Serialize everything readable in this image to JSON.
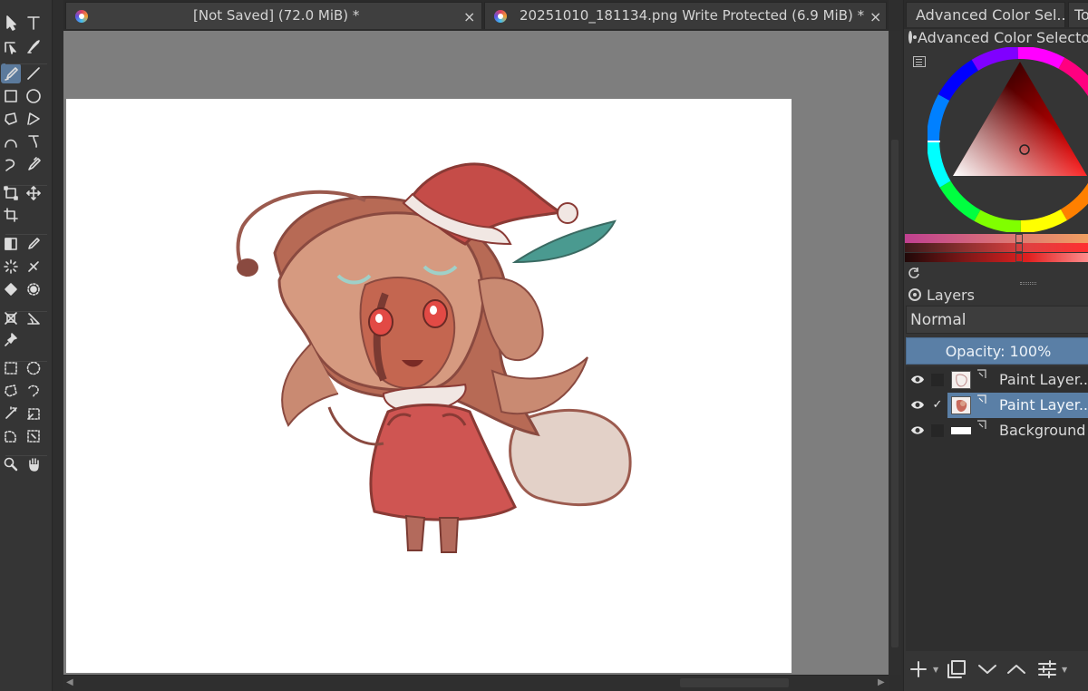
{
  "toolbox": {
    "tools": [
      {
        "name": "select-shapes-icon",
        "row": 0
      },
      {
        "name": "text-tool-icon",
        "row": 0
      },
      {
        "name": "edit-shapes-icon",
        "row": 1
      },
      {
        "name": "calligraphy-icon",
        "row": 1
      },
      {
        "name": "freehand-brush-icon",
        "row": 2,
        "active": true
      },
      {
        "name": "line-tool-icon",
        "row": 2
      },
      {
        "name": "rectangle-tool-icon",
        "row": 3
      },
      {
        "name": "ellipse-tool-icon",
        "row": 3
      },
      {
        "name": "polygon-tool-icon",
        "row": 4
      },
      {
        "name": "polyline-tool-icon",
        "row": 4
      },
      {
        "name": "bezier-curve-icon",
        "row": 5
      },
      {
        "name": "freehand-path-icon",
        "row": 5
      },
      {
        "name": "dynamic-brush-icon",
        "row": 6
      },
      {
        "name": "multibrush-icon",
        "row": 6
      },
      {
        "name": "transform-tool-icon",
        "row": 7
      },
      {
        "name": "move-tool-icon",
        "row": 7
      },
      {
        "name": "crop-tool-icon",
        "row": 8
      },
      {
        "name": "gradient-tool-icon",
        "row": 9
      },
      {
        "name": "color-picker-icon",
        "row": 9
      },
      {
        "name": "colorize-mask-icon",
        "row": 10
      },
      {
        "name": "smart-patch-icon",
        "row": 10
      },
      {
        "name": "fill-tool-icon",
        "row": 11
      },
      {
        "name": "enclose-fill-icon",
        "row": 11
      },
      {
        "name": "assistant-tool-icon",
        "row": 12
      },
      {
        "name": "measure-tool-icon",
        "row": 12
      },
      {
        "name": "reference-images-icon",
        "row": 13
      },
      {
        "name": "rectangular-selection-icon",
        "row": 14
      },
      {
        "name": "elliptical-selection-icon",
        "row": 14
      },
      {
        "name": "polygonal-selection-icon",
        "row": 15
      },
      {
        "name": "freehand-selection-icon",
        "row": 15
      },
      {
        "name": "contiguous-selection-icon",
        "row": 16
      },
      {
        "name": "similar-color-selection-icon",
        "row": 16
      },
      {
        "name": "bezier-selection-icon",
        "row": 17
      },
      {
        "name": "magnetic-selection-icon",
        "row": 17
      },
      {
        "name": "zoom-tool-icon",
        "row": 18
      },
      {
        "name": "pan-tool-icon",
        "row": 18
      }
    ]
  },
  "tabs": [
    {
      "title": "[Not Saved]  (72.0 MiB) *",
      "close": "×",
      "active": true
    },
    {
      "title": "20251010_181134.png Write Protected (6.9 MiB) *",
      "close": "×",
      "active": false
    }
  ],
  "dock_tabs": [
    {
      "label": "Advanced Color Sel..."
    },
    {
      "label": "To"
    }
  ],
  "color_selector": {
    "title": "Advanced Color Selector",
    "hue": "#ff0000",
    "current_color": "#d9414f"
  },
  "layers": {
    "title": "Layers",
    "blend_mode": "Normal",
    "opacity_label": "Opacity:  100%",
    "items": [
      {
        "name": "Paint Layer...",
        "visible": true,
        "checked": false,
        "selected": false,
        "thumb": "sketch"
      },
      {
        "name": "Paint Layer...",
        "visible": true,
        "checked": true,
        "selected": true,
        "thumb": "color"
      },
      {
        "name": "Background",
        "visible": true,
        "checked": false,
        "selected": false,
        "thumb": "white"
      }
    ]
  },
  "colors": {
    "accent": "#5a7fa6",
    "panel": "#353535",
    "canvas_bg": "#7e7e7e",
    "paper": "#ffffff"
  }
}
